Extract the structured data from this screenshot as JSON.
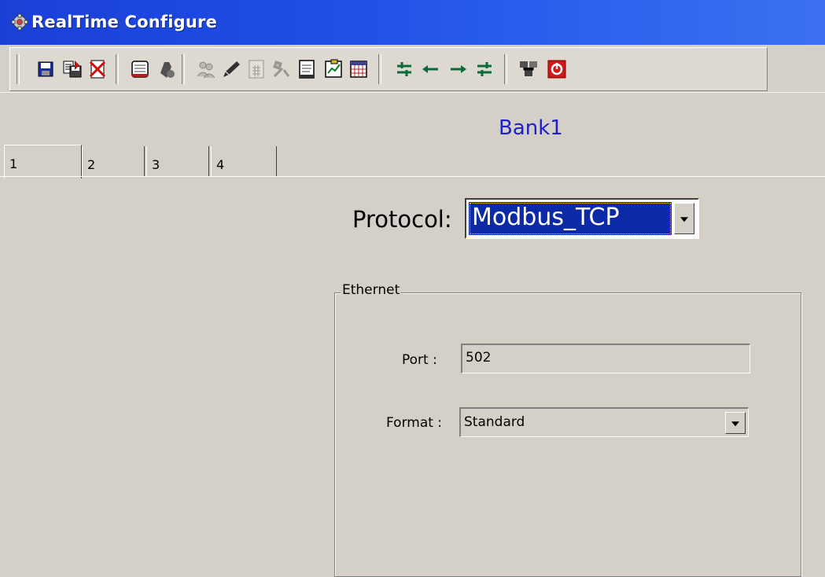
{
  "window": {
    "title": "RealTime Configure",
    "title_bar_color": "#1f4fe6",
    "icon": "gear-icon"
  },
  "toolbar": {
    "buttons": [
      {
        "name": "save-icon",
        "tooltip": ""
      },
      {
        "name": "save-as-icon",
        "tooltip": ""
      },
      {
        "name": "delete-icon",
        "tooltip": ""
      },
      {
        "name": "notepad-icon",
        "tooltip": ""
      },
      {
        "name": "tools-icon",
        "tooltip": ""
      },
      {
        "name": "users-icon",
        "tooltip": ""
      },
      {
        "name": "pencil-icon",
        "tooltip": ""
      },
      {
        "name": "calculator-icon",
        "tooltip": ""
      },
      {
        "name": "wrench-icon",
        "tooltip": ""
      },
      {
        "name": "document-icon",
        "tooltip": ""
      },
      {
        "name": "report-icon",
        "tooltip": ""
      },
      {
        "name": "grid-icon",
        "tooltip": ""
      },
      {
        "name": "first-icon",
        "tooltip": ""
      },
      {
        "name": "prev-icon",
        "tooltip": ""
      },
      {
        "name": "next-icon",
        "tooltip": ""
      },
      {
        "name": "last-icon",
        "tooltip": ""
      },
      {
        "name": "network-icon",
        "tooltip": ""
      },
      {
        "name": "power-icon",
        "tooltip": ""
      }
    ]
  },
  "bank": {
    "title": "Bank1"
  },
  "tabs": [
    {
      "label": "1",
      "active": true
    },
    {
      "label": "2",
      "active": false
    },
    {
      "label": "3",
      "active": false
    },
    {
      "label": "4",
      "active": false
    }
  ],
  "protocol": {
    "label": "Protocol:",
    "value": "Modbus_TCP",
    "highlight_color": "#0c2aa6"
  },
  "ethernet": {
    "legend": "Ethernet",
    "port_label": "Port :",
    "port_value": "502",
    "format_label": "Format :",
    "format_value": "Standard"
  },
  "colors": {
    "bank_title": "#2020c8",
    "face": "#d4d0c8"
  }
}
